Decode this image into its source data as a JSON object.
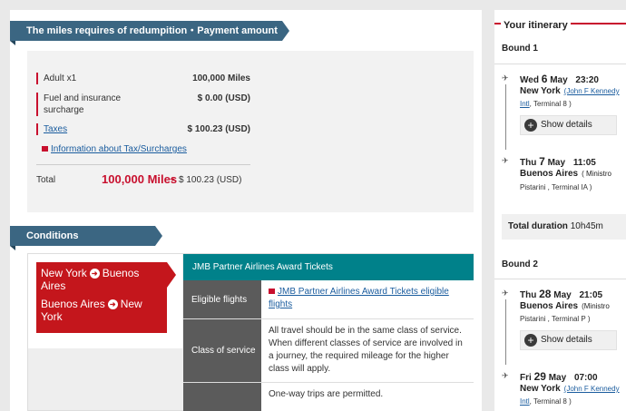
{
  "payment": {
    "banner": "The miles requires of redumpition・Payment amount",
    "rows": [
      {
        "label": "Adult x1",
        "value": "100,000 Miles"
      },
      {
        "label": "Fuel and insurance surcharge",
        "value": "$ 0.00 (USD)"
      },
      {
        "label": "Taxes",
        "value": "$ 100.23 (USD)"
      }
    ],
    "info_link": "Information about Tax/Surcharges",
    "total_label": "Total",
    "total_miles": "100,000 Miles",
    "total_plus": "+",
    "total_usd": "$ 100.23 (USD)"
  },
  "conditions": {
    "banner": "Conditions",
    "route": [
      {
        "from": "New York",
        "to": "Buenos Aires"
      },
      {
        "from": "Buenos Aires",
        "to": "New York"
      }
    ],
    "table_title": "JMB Partner Airlines Award Tickets",
    "rows": [
      {
        "key": "Eligible flights",
        "value": "JMB Partner Airlines Award Tickets eligible flights"
      },
      {
        "key": "Class of service",
        "value": "All travel should be in the same class of service. When different classes of service are involved in a journey, the required mileage for the higher class will apply."
      },
      {
        "key": "",
        "value": "One-way trips are permitted."
      }
    ]
  },
  "itinerary": {
    "title": "Your itinerary",
    "bound1": {
      "label": "Bound 1",
      "dep_dow": "Wed",
      "dep_day": "6",
      "dep_month": "May",
      "dep_time": "23:20",
      "dep_city": "New York",
      "dep_airport": "(John F Kennedy",
      "dep_sub_link": "Intl",
      "dep_terminal": ", Terminal 8 )",
      "show_details": "Show details",
      "arr_dow": "Thu",
      "arr_day": "7",
      "arr_month": "May",
      "arr_time": "11:05",
      "arr_city": "Buenos Aires",
      "arr_airport": "( Ministro",
      "arr_sub": "Pistarini , Terminal IA )",
      "duration_label": "Total duration",
      "duration": "10h45m"
    },
    "bound2": {
      "label": "Bound 2",
      "dep_dow": "Thu",
      "dep_day": "28",
      "dep_month": "May",
      "dep_time": "21:05",
      "dep_city": "Buenos Aires",
      "dep_airport": "(Ministro",
      "dep_sub": "Pistarini , Terminal P )",
      "show_details": "Show details",
      "arr_dow": "Fri",
      "arr_day": "29",
      "arr_month": "May",
      "arr_time": "07:00",
      "arr_city": "New York",
      "arr_airport": "(John F Kennedy",
      "arr_sub_link": "Intl",
      "arr_terminal": ", Terminal 8 )"
    }
  },
  "colors": {
    "accent": "#c8102e",
    "banner": "#3b6682",
    "teal": "#00818a",
    "route_red": "#c4161c"
  }
}
